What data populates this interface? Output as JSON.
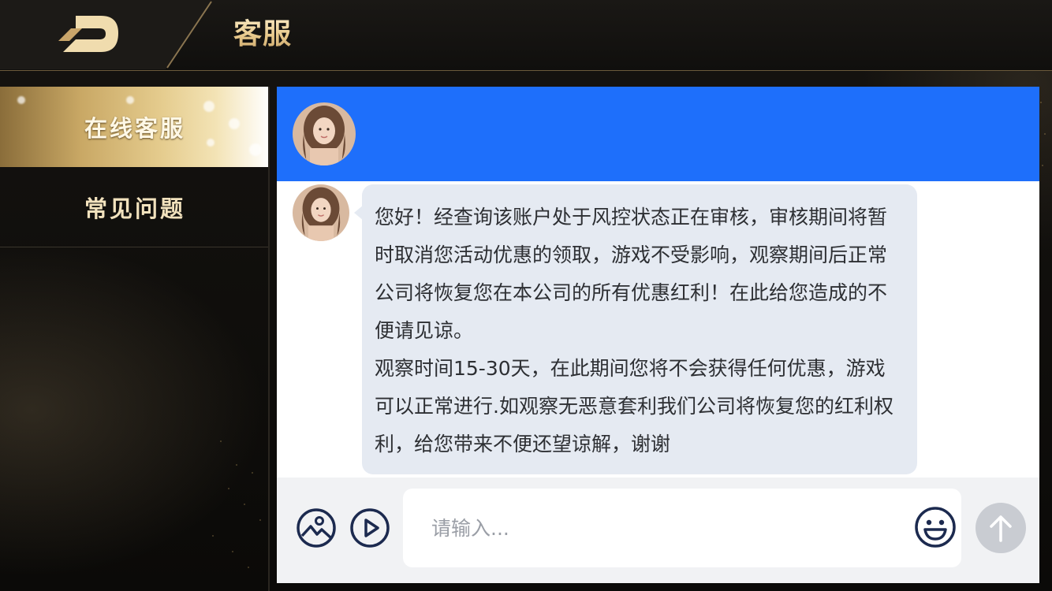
{
  "header": {
    "title": "客服"
  },
  "sidebar": {
    "items": [
      {
        "label": "在线客服",
        "active": true
      },
      {
        "label": "常见问题",
        "active": false
      }
    ]
  },
  "chat": {
    "header_color": "#1e6ffb",
    "message": {
      "paragraphs": [
        "您好！经查询该账户处于风控状态正在审核，审核期间将暂时取消您活动优惠的领取，游戏不受影响，观察期间后正常公司将恢复您在本公司的所有优惠红利！在此给您造成的不便请见谅。",
        "观察时间15-30天，在此期间您将不会获得任何优惠，游戏可以正常进行.如观察无恶意套利我们公司将恢复您的红利权利，给您带来不便还望谅解，谢谢"
      ]
    }
  },
  "input": {
    "placeholder": "请输入...",
    "value": "",
    "icons": [
      "image-icon",
      "play-icon",
      "emoji-icon",
      "arrow-up-icon"
    ]
  },
  "colors": {
    "accent_gold": "#e8c98b",
    "chat_header_blue": "#1e6ffb",
    "bubble_bg": "#e5eaf2"
  }
}
